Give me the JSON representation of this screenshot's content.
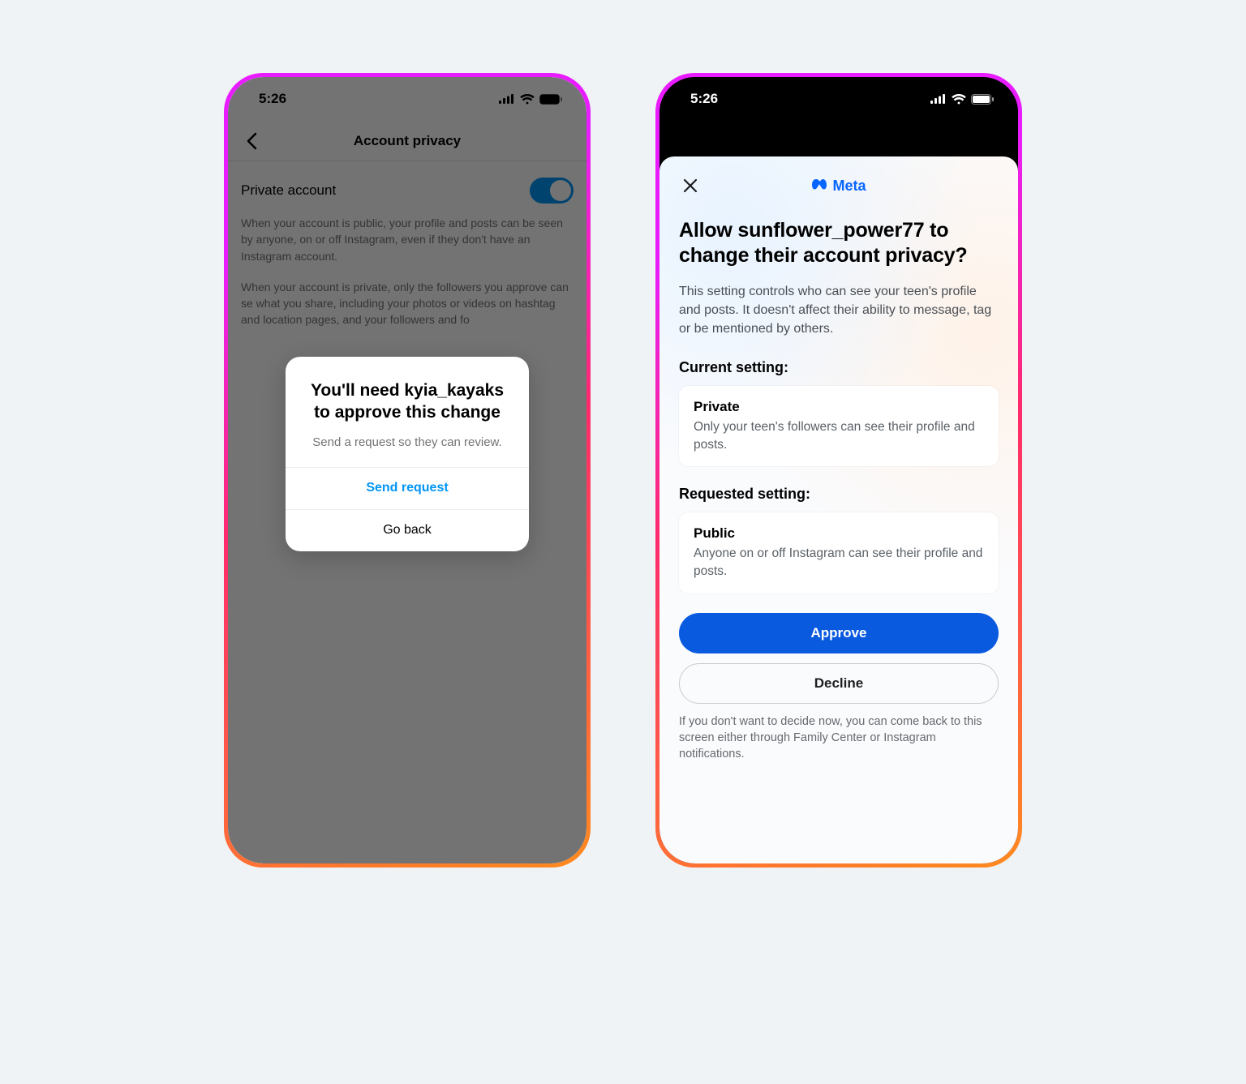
{
  "status": {
    "time": "5:26"
  },
  "left": {
    "header_title": "Account privacy",
    "row_label": "Private account",
    "desc1": "When your account is public, your profile and posts can be seen by anyone, on or off Instagram, even if they don't have an Instagram account.",
    "desc2": "When your account is private, only the followers you approve can se what you share, including your photos or videos on hashtag and location pages, and your followers and fo",
    "alert": {
      "title": "You'll need kyia_kayaks to approve this change",
      "subtitle": "Send a request so they can review.",
      "primary": "Send request",
      "secondary": "Go back"
    }
  },
  "right": {
    "brand": "Meta",
    "title": "Allow sunflower_power77 to change their account privacy?",
    "subtitle": "This setting controls who can see your teen's profile and posts. It doesn't affect their ability to message, tag or be mentioned by others.",
    "current_label": "Current setting:",
    "current": {
      "title": "Private",
      "sub": "Only your teen's followers can see their profile and posts."
    },
    "requested_label": "Requested setting:",
    "requested": {
      "title": "Public",
      "sub": "Anyone on or off Instagram can see their profile and posts."
    },
    "approve": "Approve",
    "decline": "Decline",
    "footnote": "If you don't want to decide now, you can come back to this screen either through Family Center or Instagram notifications."
  }
}
